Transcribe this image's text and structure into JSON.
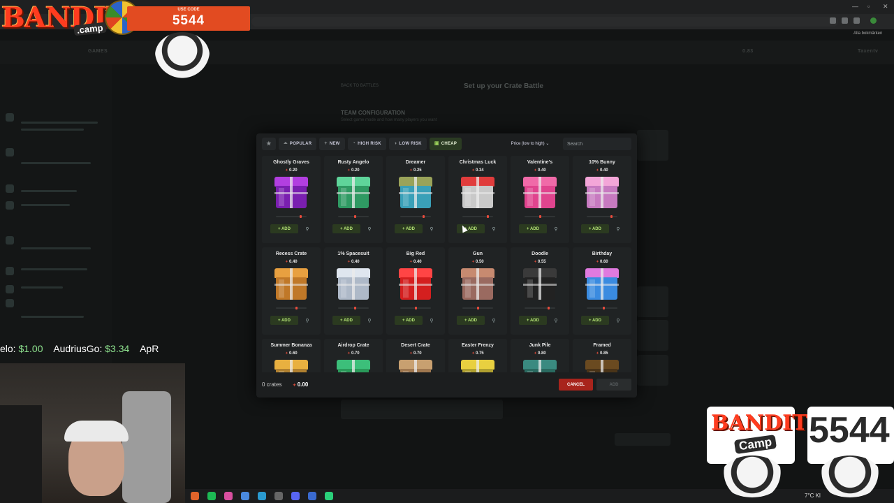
{
  "browser": {
    "bookmarks_label": "Alla bokmärken",
    "win_min": "—",
    "win_max": "▫",
    "win_close": "✕"
  },
  "stream": {
    "logo_bandit": "BANDIT",
    "logo_camp": ".camp",
    "code_label": "USE CODE",
    "code_value": "5544",
    "ticker": [
      {
        "name": "elo:",
        "amount": "$1.00"
      },
      {
        "name": "AudriusGo:",
        "amount": "$3.34"
      },
      {
        "name": "ApR",
        "amount": ""
      }
    ],
    "br_bandit": "BANDIT",
    "br_camp": "Camp",
    "br_code": "5544",
    "weather": "7°C Kl"
  },
  "background_site": {
    "back_label": "BACK TO BATTLES",
    "page_title": "Set up your Crate Battle",
    "team_title": "TEAM CONFIGURATION",
    "team_sub": "Select game mode and how many players you want",
    "nav_games": "GAMES",
    "balance": "0.83",
    "user": "Taxentv"
  },
  "modal": {
    "filters": [
      {
        "label": "POPULAR",
        "icon": "flame-icon",
        "glyph": "⏶",
        "active": false
      },
      {
        "label": "NEW",
        "icon": "plus-icon",
        "glyph": "+",
        "active": false
      },
      {
        "label": "HIGH RISK",
        "icon": "dial-icon",
        "glyph": "◔",
        "active": false
      },
      {
        "label": "LOW RISK",
        "icon": "dial-icon",
        "glyph": "◑",
        "active": false
      },
      {
        "label": "CHEAP",
        "icon": "wallet-icon",
        "glyph": "▣",
        "active": true
      }
    ],
    "sort_label": "Price (low to high) ⌄",
    "search_placeholder": "Search",
    "add_label": "ADD",
    "crates": [
      {
        "name": "Ghostly Graves",
        "price": "0.20",
        "lid": "#b23fe0",
        "body": "#7a1fb0",
        "risk": 0.82
      },
      {
        "name": "Rusty Angelo",
        "price": "0.20",
        "lid": "#5fd49a",
        "body": "#2f9a63",
        "risk": 0.55
      },
      {
        "name": "Dreamer",
        "price": "0.25",
        "lid": "#9aa35a",
        "body": "#3aa0b8",
        "risk": 0.78
      },
      {
        "name": "Christmas Luck",
        "price": "0.34",
        "lid": "#e03c3c",
        "body": "#c9c9c9",
        "risk": 0.85
      },
      {
        "name": "Valentine's",
        "price": "0.40",
        "lid": "#f06aa8",
        "body": "#e0448e",
        "risk": 0.5
      },
      {
        "name": "10% Bunny",
        "price": "0.40",
        "lid": "#f3a6d8",
        "body": "#c77ac0",
        "risk": 0.82
      },
      {
        "name": "Recess Crate",
        "price": "0.40",
        "lid": "#e8a040",
        "body": "#c07828",
        "risk": 0.68
      },
      {
        "name": "1% Spacesuit",
        "price": "0.40",
        "lid": "#dfe6ef",
        "body": "#aeb9c8",
        "risk": 0.55
      },
      {
        "name": "Big Red",
        "price": "0.40",
        "lid": "#ff4545",
        "body": "#d41f1f",
        "risk": 0.5
      },
      {
        "name": "Gun",
        "price": "0.50",
        "lid": "#c78a70",
        "body": "#9a6a60",
        "risk": 0.5
      },
      {
        "name": "Doodle",
        "price": "0.55",
        "lid": "#3a3a3a",
        "body": "#222",
        "risk": 0.8
      },
      {
        "name": "Birthday",
        "price": "0.60",
        "lid": "#e07adf",
        "body": "#3a8be0",
        "risk": 0.55
      },
      {
        "name": "Summer Bonanza",
        "price": "0.60",
        "lid": "#e8b040",
        "body": "#b08030",
        "risk": 0.5
      },
      {
        "name": "Airdrop Crate",
        "price": "0.70",
        "lid": "#3cbf7a",
        "body": "#2a9a5a",
        "risk": 0.5
      },
      {
        "name": "Desert Crate",
        "price": "0.70",
        "lid": "#c8a070",
        "body": "#a07850",
        "risk": 0.5
      },
      {
        "name": "Easter Frenzy",
        "price": "0.75",
        "lid": "#e8d040",
        "body": "#b0a030",
        "risk": 0.5
      },
      {
        "name": "Junk Pile",
        "price": "0.80",
        "lid": "#3a8a80",
        "body": "#2a6a60",
        "risk": 0.5
      },
      {
        "name": "Framed",
        "price": "0.85",
        "lid": "#6a4a20",
        "body": "#4a3418",
        "risk": 0.5
      }
    ],
    "footer": {
      "count": "0 crates",
      "total": "0.00",
      "cancel": "CANCEL",
      "add": "ADD"
    }
  }
}
